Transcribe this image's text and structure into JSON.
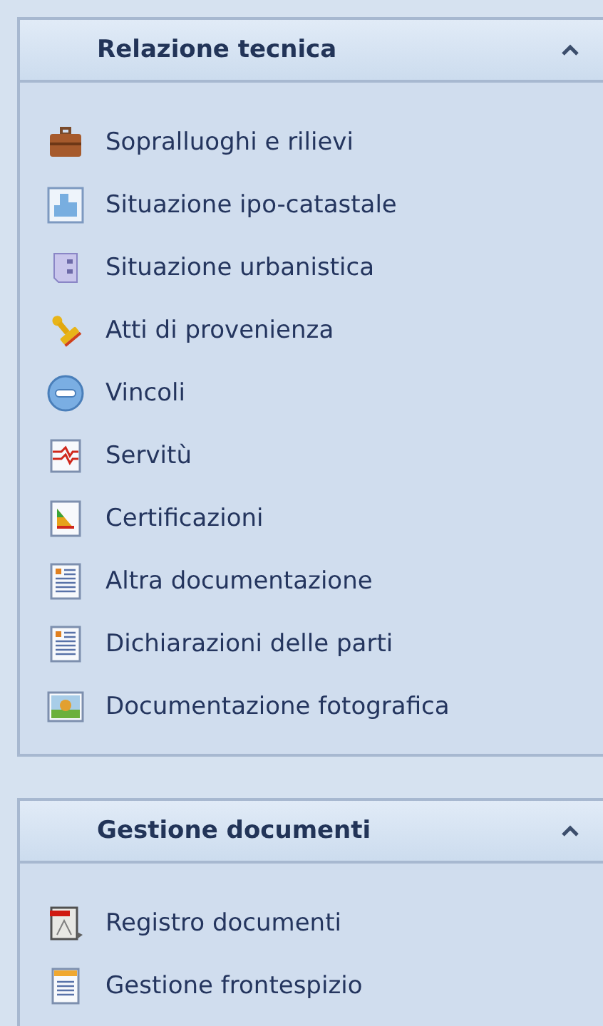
{
  "panels": [
    {
      "title": "Relazione tecnica",
      "expanded": true,
      "items": [
        {
          "label": "Sopralluoghi e rilievi",
          "kind": "briefcase"
        },
        {
          "label": "Situazione ipo-catastale",
          "kind": "plan"
        },
        {
          "label": "Situazione urbanistica",
          "kind": "cabinet"
        },
        {
          "label": "Atti di provenienza",
          "kind": "stamp"
        },
        {
          "label": "Vincoli",
          "kind": "minus"
        },
        {
          "label": "Servitù",
          "kind": "chart"
        },
        {
          "label": "Certificazioni",
          "kind": "energy"
        },
        {
          "label": "Altra documentazione",
          "kind": "document"
        },
        {
          "label": "Dichiarazioni delle parti",
          "kind": "document"
        },
        {
          "label": "Documentazione fotografica",
          "kind": "photo"
        }
      ]
    },
    {
      "title": "Gestione documenti",
      "expanded": true,
      "items": [
        {
          "label": "Registro documenti",
          "kind": "register"
        },
        {
          "label": "Gestione frontespizio",
          "kind": "sheet"
        }
      ]
    }
  ]
}
